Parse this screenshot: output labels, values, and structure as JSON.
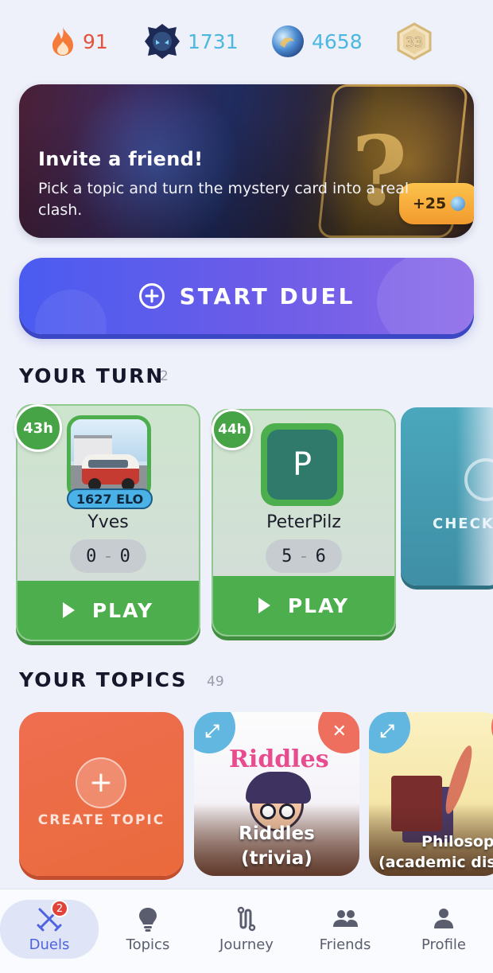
{
  "stats": {
    "streak": {
      "icon": "flame-icon",
      "value": "91",
      "color": "#e5533d"
    },
    "rank": {
      "icon": "rank-emblem-icon",
      "value": "1731",
      "color": "#4cb7e0"
    },
    "gems": {
      "icon": "gem-orb-icon",
      "value": "4658",
      "color": "#4cb7e0"
    },
    "level": {
      "icon": "level-hexagon-icon",
      "value": "33"
    }
  },
  "invite_banner": {
    "title": "Invite a friend!",
    "description": "Pick a topic and turn the mystery card into a real clash.",
    "bonus": "+25",
    "bonus_icon": "gem-icon"
  },
  "start_duel": {
    "label": "START DUEL",
    "icon": "plus-circle-icon"
  },
  "your_turn": {
    "title": "YOUR TURN",
    "count": "2",
    "cards": [
      {
        "timer": "43h",
        "avatar": "photo-van",
        "elo": "1627 ELO",
        "name": "Yves",
        "score_left": "0",
        "score_right": "0",
        "play_label": "PLAY"
      },
      {
        "timer": "44h",
        "avatar_letter": "P",
        "name": "PeterPilz",
        "score_left": "5",
        "score_right": "6",
        "play_label": "PLAY"
      }
    ],
    "check_card": {
      "label": "CHECK"
    }
  },
  "your_topics": {
    "title": "YOUR TOPICS",
    "count": "49",
    "create_label": "CREATE TOPIC",
    "topics": [
      {
        "art_word": "Riddles",
        "title_line1": "Riddles",
        "title_line2": "(trivia)"
      },
      {
        "title_line1": "Philosop",
        "title_line2": "(academic dis"
      }
    ]
  },
  "tabbar": {
    "tabs": [
      {
        "label": "Duels",
        "icon": "crossed-swords-icon",
        "badge": "2",
        "active": true
      },
      {
        "label": "Topics",
        "icon": "lightbulb-icon"
      },
      {
        "label": "Journey",
        "icon": "path-icon"
      },
      {
        "label": "Friends",
        "icon": "people-icon"
      },
      {
        "label": "Profile",
        "icon": "person-icon"
      }
    ],
    "accent": "#4f63e0"
  }
}
